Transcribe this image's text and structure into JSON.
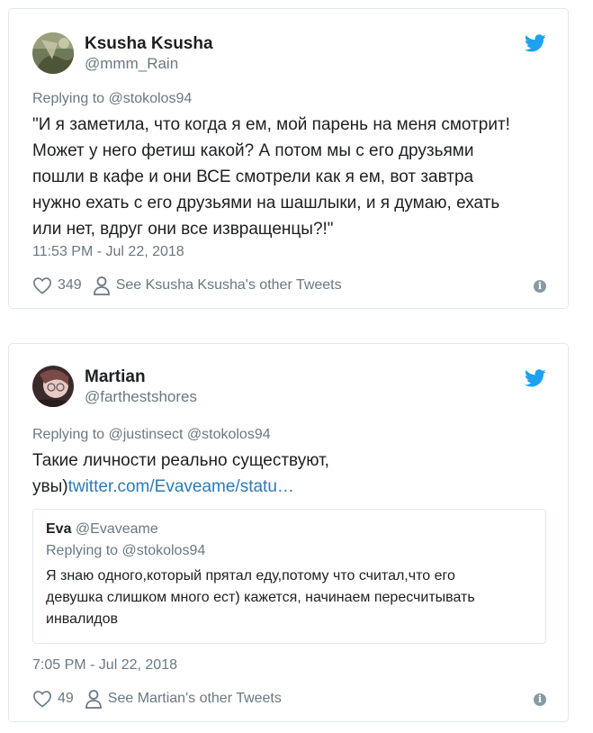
{
  "tweets": [
    {
      "author_name": "Ksusha Ksusha",
      "author_handle": "@mmm_Rain",
      "reply_prefix": "Replying to",
      "reply_mentions": "@stokolos94",
      "text_lines": [
        "\"И я заметила, что когда я ем, мой парень на меня смотрит!",
        "Может у него фетиш какой? А потом мы с его друзьями",
        "пошли в кафе и они ВСЕ смотрели как я ем, вот завтра",
        "нужно ехать с его друзьями на шашлыки, и я думаю, ехать",
        "или нет, вдруг они все извращенцы?!\""
      ],
      "timestamp": "11:53 PM - Jul 22, 2018",
      "likes": "349",
      "other_tweets_label": "See Ksusha Ksusha's other Tweets",
      "info_icon": "i"
    },
    {
      "author_name": "Martian",
      "author_handle": "@farthestshores",
      "reply_prefix": "Replying to",
      "reply_mentions": "@justinsect @stokolos94",
      "text_line1": "Такие личности реально существуют,",
      "text_line2": "увы)",
      "link_text": "twitter.com/Evaveame/statu…",
      "quote": {
        "name": "Eva",
        "handle": "@Evaveame",
        "reply_prefix": "Replying to",
        "reply_mentions": "@stokolos94",
        "text_lines": [
          "Я знаю одного,который прятал еду,потому что считал,что его",
          "девушка слишком много ест) кажется, начинаем пересчитывать",
          "инвалидов"
        ]
      },
      "timestamp": "7:05 PM - Jul 22, 2018",
      "likes": "49",
      "other_tweets_label": "See Martian's other Tweets",
      "info_icon": "i"
    }
  ],
  "icons": {
    "brand": "twitter-bird-icon",
    "like": "heart-icon",
    "profile": "person-icon",
    "info": "info-icon"
  },
  "colors": {
    "twitter_blue": "#1da1f2",
    "link": "#2b7bb9",
    "secondary_text": "#697882",
    "border": "#e1e8ed"
  }
}
